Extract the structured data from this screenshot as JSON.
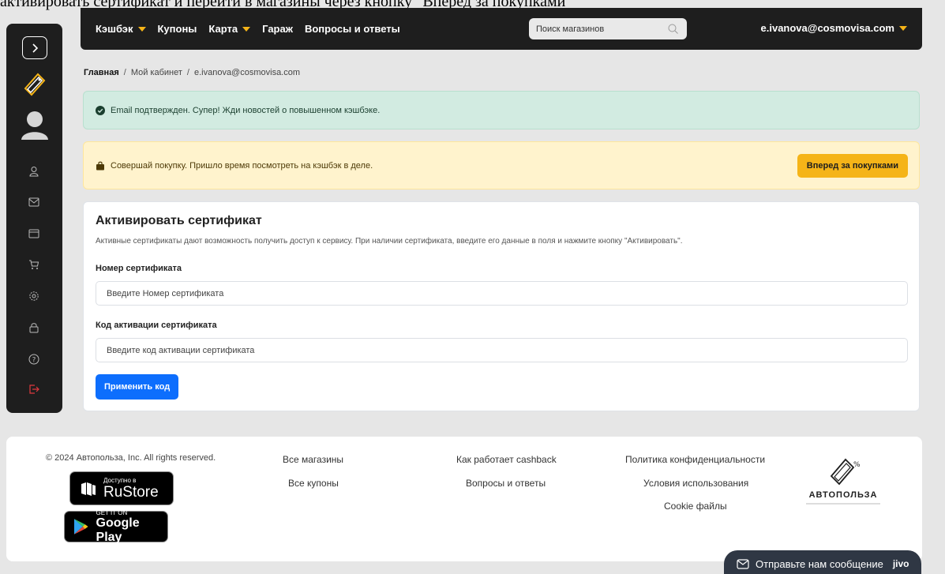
{
  "caption": "активировать сертификат и перейти в магазины через кнопку \"Вперед за покупками\"",
  "colors": {
    "accent": "#f5b418",
    "primary": "#0d6efd",
    "dark": "#1e1e1e",
    "success_bg": "#d2ebe1",
    "warning_bg": "#fff3cd",
    "logout": "#e0393e"
  },
  "sidebar": {
    "toggle_icon": "chevron-right-icon",
    "logo_icon": "coupon-logo-icon",
    "avatar_icon": "user-avatar-icon",
    "items": [
      {
        "icon": "user-icon"
      },
      {
        "icon": "mail-icon"
      },
      {
        "icon": "wallet-icon"
      },
      {
        "icon": "cart-icon"
      },
      {
        "icon": "gear-icon"
      },
      {
        "icon": "lock-icon"
      },
      {
        "icon": "help-icon"
      },
      {
        "icon": "logout-icon"
      }
    ]
  },
  "nav": {
    "items": [
      {
        "label": "Кэшбэк",
        "dropdown": true
      },
      {
        "label": "Купоны",
        "dropdown": false
      },
      {
        "label": "Карта",
        "dropdown": true
      },
      {
        "label": "Гараж",
        "dropdown": false
      },
      {
        "label": "Вопросы и ответы",
        "dropdown": false
      }
    ],
    "search_placeholder": "Поиск магазинов",
    "user_email": "e.ivanova@cosmovisa.com"
  },
  "breadcrumb": {
    "home": "Главная",
    "separator": "/",
    "cabinet": "Мой кабинет",
    "current": "e.ivanova@cosmovisa.com"
  },
  "alerts": {
    "success": "Email подтвержден. Супер! Жди новостей о повышенном кэшбэке.",
    "warning": "Совершай покупку. Пришло время посмотреть на кэшбэк в деле.",
    "warning_button": "Вперед за покупками"
  },
  "certificate": {
    "title": "Активировать сертификат",
    "description": "Активные сертификаты дают возможность получить доступ к сервису. При наличии сертификата, введите его данные в поля и нажмите кнопку \"Активировать\".",
    "number_label": "Номер сертификата",
    "number_placeholder": "Введите Номер сертификата",
    "code_label": "Код активации сертификата",
    "code_placeholder": "Введите код активации сертификата",
    "apply_button": "Применить код"
  },
  "footer": {
    "copyright": "© 2024 Автопольза, Inc. All rights reserved.",
    "rustore_small": "Доступно в",
    "rustore_big": "RuStore",
    "gplay_small": "GET IT ON",
    "gplay_big": "Google Play",
    "col1": [
      "Все магазины",
      "Все купоны"
    ],
    "col2": [
      "Как работает cashback",
      "Вопросы и ответы"
    ],
    "col3": [
      "Политика конфиденциальности",
      "Условия использования",
      "Cookie файлы"
    ],
    "logo_text": "АВТОПОЛЬЗА"
  },
  "chat": {
    "label": "Отправьте нам сообщение",
    "brand": "jivo"
  }
}
